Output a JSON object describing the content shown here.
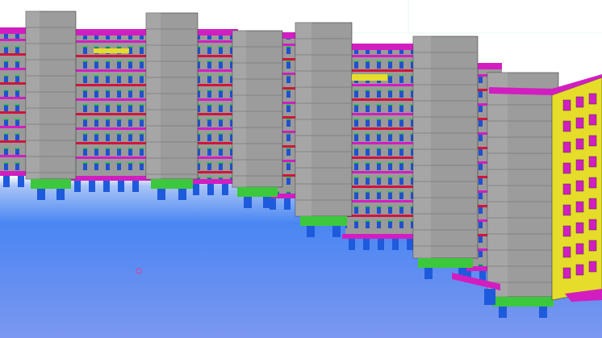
{
  "viewport": {
    "kind": "3d-model-view",
    "background_top": "#ffffff",
    "background_bottom": "#6f8ff2",
    "background_mid": "#3c7cf0"
  },
  "palette": {
    "wall_gray": "#9c9c9c",
    "wall_gray_light": "#b4b4b4",
    "slab_magenta": "#d21ec0",
    "balcony_red": "#d2143c",
    "wall_yellow": "#e6dc2a",
    "column_green": "#3cc83c",
    "footing_blue": "#1e5adc",
    "window_blue": "#2050d0",
    "edge_dark": "#3a3a3a"
  },
  "cursor_marker": {
    "symbol": "crosshair-circle",
    "color": "#e0409a"
  }
}
